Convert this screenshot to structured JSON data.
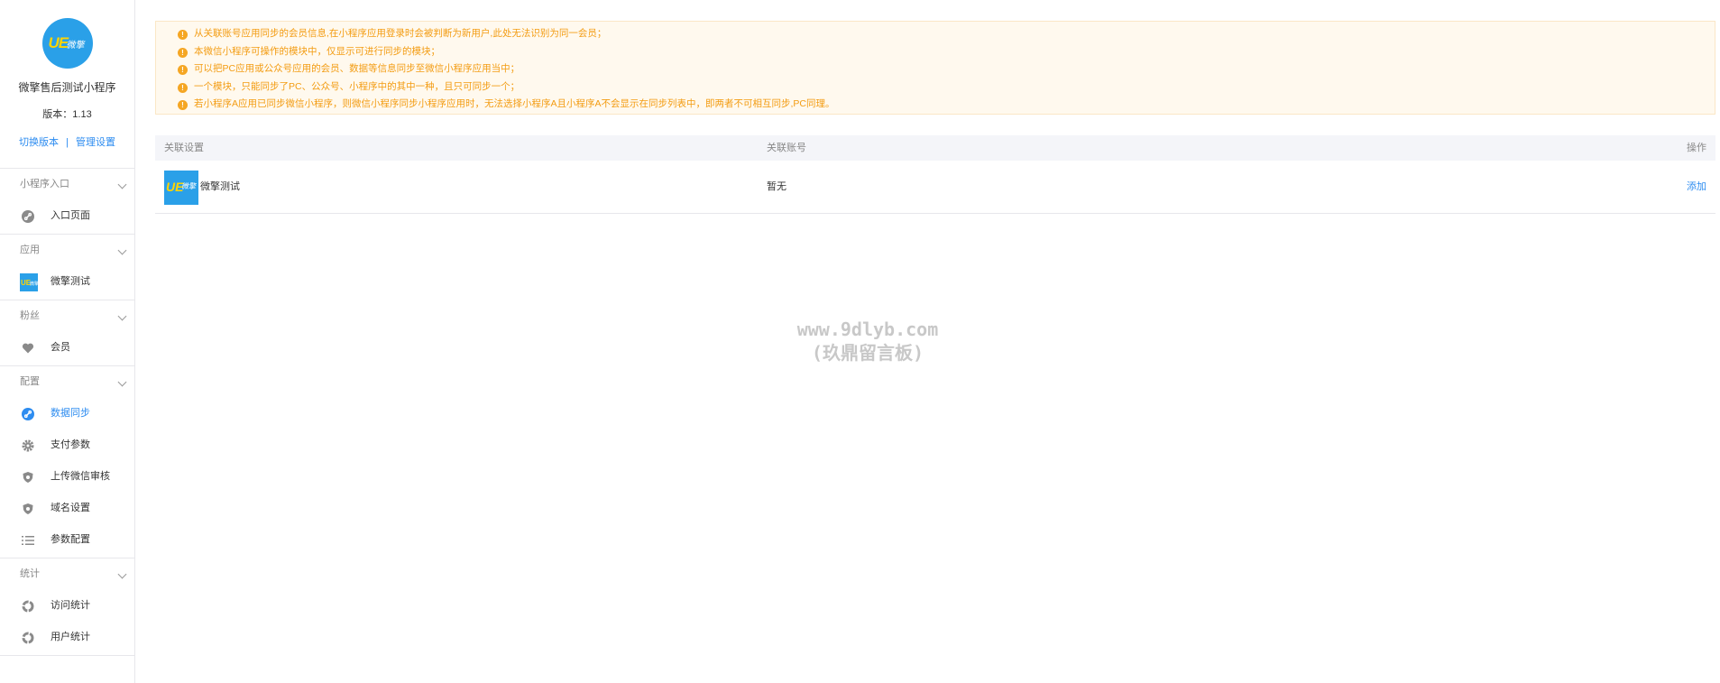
{
  "account": {
    "logo_text": "UE",
    "logo_sub": "微擎",
    "name": "微擎售后测试小程序",
    "version": "版本：1.13",
    "switch_version": "切换版本",
    "separator": "|",
    "manage_settings": "管理设置"
  },
  "sidebar": {
    "groups": [
      {
        "title": "小程序入口",
        "items": [
          {
            "label": "入口页面",
            "icon": "link-icon"
          }
        ]
      },
      {
        "title": "应用",
        "items": [
          {
            "label": "微擎测试",
            "icon": "app-logo"
          }
        ]
      },
      {
        "title": "粉丝",
        "items": [
          {
            "label": "会员",
            "icon": "heart-icon"
          }
        ]
      },
      {
        "title": "配置",
        "items": [
          {
            "label": "数据同步",
            "icon": "sync-icon",
            "active": true
          },
          {
            "label": "支付参数",
            "icon": "gear-icon"
          },
          {
            "label": "上传微信审核",
            "icon": "shield-icon"
          },
          {
            "label": "域名设置",
            "icon": "shield-icon"
          },
          {
            "label": "参数配置",
            "icon": "list-icon"
          }
        ]
      },
      {
        "title": "统计",
        "items": [
          {
            "label": "访问统计",
            "icon": "pie-icon"
          },
          {
            "label": "用户统计",
            "icon": "pie-icon"
          }
        ]
      }
    ]
  },
  "notice": {
    "icon_glyph": "!",
    "lines": [
      "从关联账号应用同步的会员信息,在小程序应用登录时会被判断为新用户,此处无法识别为同一会员；",
      "本微信小程序可操作的模块中，仅显示可进行同步的模块；",
      "可以把PC应用或公众号应用的会员、数据等信息同步至微信小程序应用当中；",
      "一个模块，只能同步了PC、公众号、小程序中的其中一种，且只可同步一个；",
      "若小程序A应用已同步微信小程序，则微信小程序同步小程序应用时，无法选择小程序A且小程序A不会显示在同步列表中，即两者不可相互同步,PC同理。"
    ]
  },
  "table": {
    "headers": {
      "setting": "关联设置",
      "account": "关联账号",
      "action": "操作"
    },
    "rows": [
      {
        "name": "微擎测试",
        "linked": "暂无",
        "action": "添加",
        "logo_text": "UE",
        "logo_sub": "微擎"
      }
    ]
  },
  "watermark": {
    "line1": "www.9dlyb.com",
    "line2": "(玖鼎留言板)"
  },
  "colors": {
    "accent": "#2d8cf0",
    "notice_text": "#f39c12",
    "notice_bg": "#fff9ee"
  }
}
